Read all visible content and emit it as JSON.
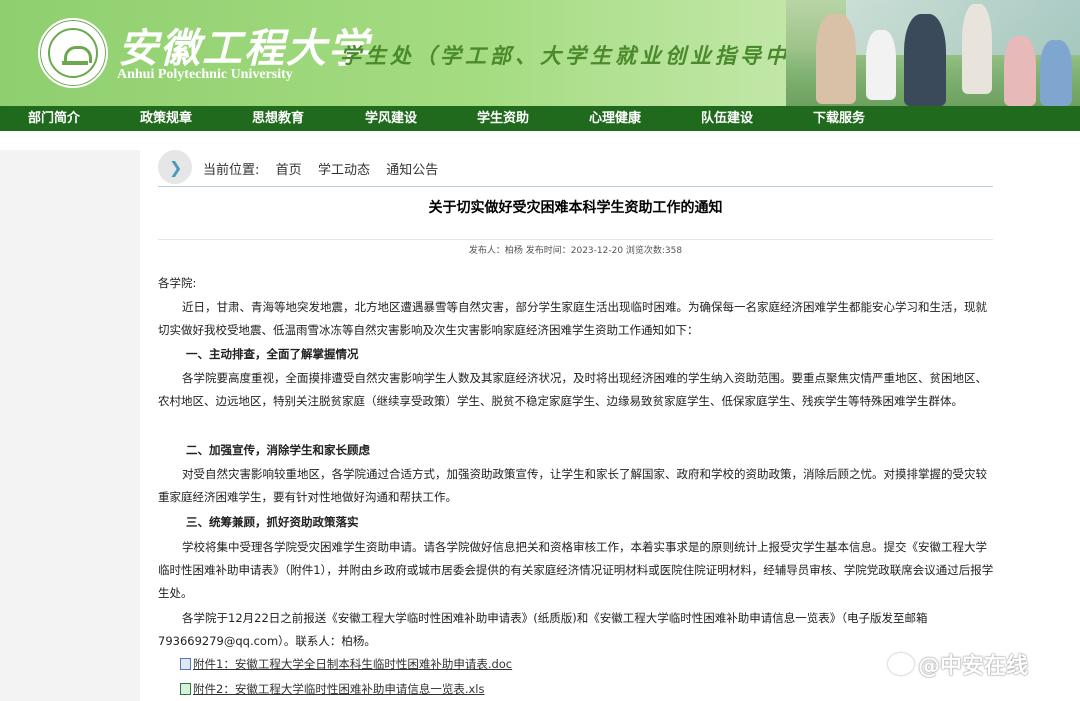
{
  "header": {
    "university_cn": "安徽工程大学",
    "university_en": "Anhui Polytechnic University",
    "department": "学生处（学工部、大学生就业创业指导中心）"
  },
  "nav": {
    "items": [
      "部门简介",
      "政策规章",
      "思想教育",
      "学风建设",
      "学生资助",
      "心理健康",
      "队伍建设",
      "下载服务"
    ]
  },
  "breadcrumb": {
    "prefix": "当前位置:",
    "items": [
      "首页",
      "学工动态",
      "通知公告"
    ]
  },
  "article": {
    "title": "关于切实做好受灾困难本科学生资助工作的通知",
    "meta": "发布人：柏杨  发布时间：2023-12-20  浏览次数:358",
    "salutation": "各学院:",
    "intro": "近日，甘肃、青海等地突发地震，北方地区遭遇暴雪等自然灾害，部分学生家庭生活出现临时困难。为确保每一名家庭经济困难学生都能安心学习和生活，现就切实做好我校受地震、低温雨雪冰冻等自然灾害影响及次生灾害影响家庭经济困难学生资助工作通知如下：",
    "h1": "一、主动排查，全面了解掌握情况",
    "p1": "各学院要高度重视，全面摸排遭受自然灾害影响学生人数及其家庭经济状况，及时将出现经济困难的学生纳入资助范围。要重点聚焦灾情严重地区、贫困地区、农村地区、边远地区，特别关注脱贫家庭（继续享受政策）学生、脱贫不稳定家庭学生、边缘易致贫家庭学生、低保家庭学生、残疾学生等特殊困难学生群体。",
    "h2": "二、加强宣传，消除学生和家长顾虑",
    "p2": "对受自然灾害影响较重地区，各学院通过合适方式，加强资助政策宣传，让学生和家长了解国家、政府和学校的资助政策，消除后顾之忧。对摸排掌握的受灾较重家庭经济困难学生，要有针对性地做好沟通和帮扶工作。",
    "h3": "三、统筹兼顾，抓好资助政策落实",
    "p3": "学校将集中受理各学院受灾困难学生资助申请。请各学院做好信息把关和资格审核工作，本着实事求是的原则统计上报受灾学生基本信息。提交《安徽工程大学临时性困难补助申请表》（附件1），并附由乡政府或城市居委会提供的有关家庭经济情况证明材料或医院住院证明材料，经辅导员审核、学院党政联席会议通过后报学生处。",
    "p4": "各学院于12月22日之前报送《安徽工程大学临时性困难补助申请表》(纸质版)和《安徽工程大学临时性困难补助申请信息一览表》（电子版发至邮箱793669279@qq.com）。联系人：柏杨。",
    "attachments": [
      "附件1：安徽工程大学全日制本科生临时性困难补助申请表.doc",
      "附件2：安徽工程大学临时性困难补助申请信息一览表.xls"
    ]
  },
  "watermark": "@中安在线"
}
